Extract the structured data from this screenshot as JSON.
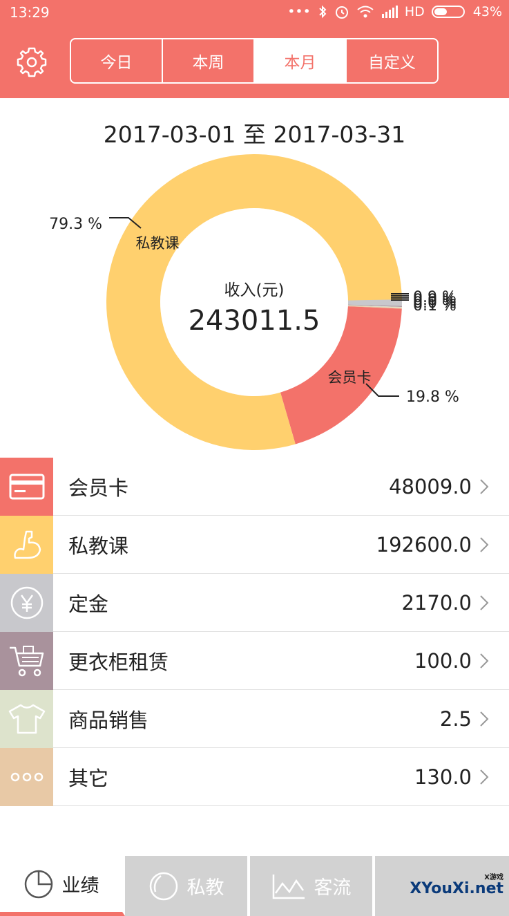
{
  "status_bar": {
    "time": "13:29",
    "network": "HD",
    "battery": "43%"
  },
  "header": {
    "tabs": [
      {
        "label": "今日",
        "active": false
      },
      {
        "label": "本周",
        "active": false
      },
      {
        "label": "本月",
        "active": true
      },
      {
        "label": "自定义",
        "active": false
      }
    ]
  },
  "date_range": "2017-03-01 至 2017-03-31",
  "chart_data": {
    "type": "pie",
    "center_label": "收入(元)",
    "center_value": "243011.5",
    "slices": [
      {
        "name": "私教课",
        "percent": 79.3,
        "value": 192600.0,
        "color": "#ffd06e",
        "label": "79.3 %"
      },
      {
        "name": "会员卡",
        "percent": 19.8,
        "value": 48009.0,
        "color": "#f3726a",
        "label": "19.8 %"
      },
      {
        "name": "定金",
        "percent": 0.9,
        "value": 2170.0,
        "color": "#c8c8cc",
        "label": "0.9 %"
      },
      {
        "name": "更衣柜租赁",
        "percent": 0.0,
        "value": 100.0,
        "color": "#a9929c",
        "label": "0.0 %"
      },
      {
        "name": "商品销售",
        "percent": 0.0,
        "value": 2.5,
        "color": "#dde3cc",
        "label": "0.0 %"
      },
      {
        "name": "其它",
        "percent": 0.1,
        "value": 130.0,
        "color": "#e8c9a6",
        "label": "0.1 %"
      }
    ]
  },
  "income_items": [
    {
      "label": "会员卡",
      "value": "48009.0",
      "color": "#f3726a",
      "icon": "card-icon"
    },
    {
      "label": "私教课",
      "value": "192600.0",
      "color": "#ffd06e",
      "icon": "muscle-icon"
    },
    {
      "label": "定金",
      "value": "2170.0",
      "color": "#c8c8cc",
      "icon": "yen-icon"
    },
    {
      "label": "更衣柜租赁",
      "value": "100.0",
      "color": "#a9929c",
      "icon": "cart-icon"
    },
    {
      "label": "商品销售",
      "value": "2.5",
      "color": "#dde3cc",
      "icon": "shirt-icon"
    },
    {
      "label": "其它",
      "value": "130.0",
      "color": "#e8c9a6",
      "icon": "more-icon"
    }
  ],
  "bottom_nav": [
    {
      "label": "业绩",
      "active": true,
      "icon": "pie-chart-icon"
    },
    {
      "label": "私教",
      "active": false,
      "icon": "circle-icon"
    },
    {
      "label": "客流",
      "active": false,
      "icon": "line-chart-icon"
    }
  ],
  "watermark": {
    "top": "X游戏",
    "main": "XYouXi.net"
  },
  "colors": {
    "accent": "#f3726a",
    "inactive_tab": "#d2d2d2"
  }
}
